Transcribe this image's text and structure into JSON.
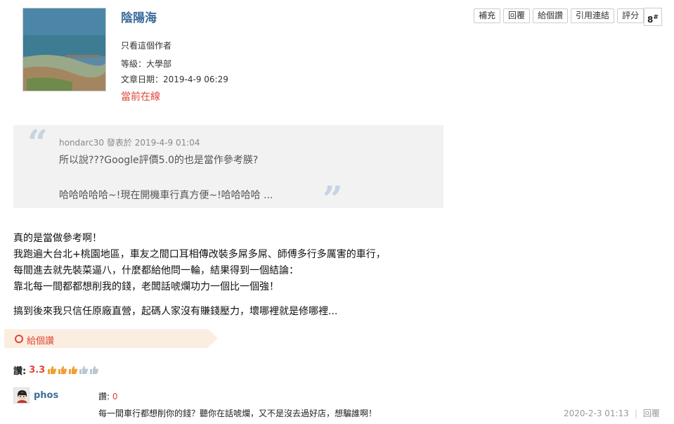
{
  "author": {
    "name": "陰陽海",
    "only_author": "只看這個作者",
    "level": "等級：大學部",
    "post_date": "文章日期：2019-4-9 06:29",
    "online": "當前在線"
  },
  "toolbar": {
    "supplement": "補充",
    "reply": "回覆",
    "give_like": "給個讚",
    "quote_link": "引用連結",
    "rate": "評分",
    "floor_number": "8",
    "floor_suffix": "#"
  },
  "quote": {
    "meta": "hondarc30 發表於 2019-4-9 01:04",
    "line1": "所以說???Google評價5.0的也是當作參考朠?",
    "line2": "哈哈哈哈哈~!現在開機車行真方便~!哈哈哈哈 ..."
  },
  "post_body": {
    "p1_l1": "真的是當做參考啊！",
    "p1_l2": "我跑遍大台北+桃園地區，車友之間口耳相傳改裝多屌多屌、師傅多行多厲害的車行，",
    "p1_l3": "每間進去就先裝菜逼八，什麼都給他問一輪，結果得到一個結論：",
    "p1_l4": "靠北每一間都都想削我的錢，老闆話唬爛功力一個比一個強！",
    "p2_l1": "搞到後來我只信任原廠直營，起碼人家沒有賺錢壓力，壞哪裡就是修哪裡..."
  },
  "like_bar": {
    "label": "給個讚"
  },
  "rating": {
    "label": "讚:",
    "value": "3.3",
    "stars_full": 3,
    "stars_total": 5
  },
  "comment": {
    "user": "phos",
    "rating_label": "讚:",
    "rating_value": "0",
    "text": "每一間車行都想削你的錢？聽你在話唬爛，又不是沒去過好店，想騙誰啊！",
    "date": "2020-2-3 01:13",
    "sep": "|",
    "reply": "回覆"
  },
  "colors": {
    "link_blue": "#3e6d9c",
    "accent_red": "#e0463a",
    "quote_bg": "#f2f2f2",
    "like_bar_bg": "#fbeee0"
  }
}
